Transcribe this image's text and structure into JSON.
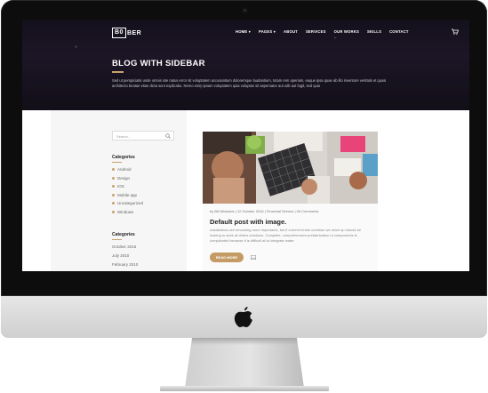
{
  "site": {
    "logo_box": "B0",
    "logo_rest": "BER",
    "nav": [
      "HOME ▾",
      "PAGES ▾",
      "ABOUT",
      "SERVICES",
      "OUR WORKS",
      "SKILLS",
      "CONTACT"
    ]
  },
  "hero": {
    "title": "BLOG WITH SIDEBAR",
    "description": "Sed ut perspiciatis unde omnis iste natus error sit voluptatem accusantium doloremque laudantium, totam rem aperiam, eaque ipsa quae ab illo inventore veritatis et quasi architecto beatae vitae dicta sunt explicabo. Nemo enim ipsam voluptatem quia voluptas sit aspernatur aut odit aut fugit, sed quia"
  },
  "sidebar": {
    "search_placeholder": "Search...",
    "categories_heading": "Categories",
    "categories": [
      "Android",
      "Design",
      "IOS",
      "Mobile app",
      "Uncategorized",
      "Windows"
    ],
    "archives_heading": "Categories",
    "archives": [
      "October 2016",
      "July 2010",
      "February 2010"
    ]
  },
  "post": {
    "meta": "by Bill Michaels   |   12 October 2016   |   Financial Service   |   06 Comments",
    "title": "Default post with image.",
    "excerpt": "Installations are becoming more importants, but if current trends continue we seize up should be looking to seek at others solutions. Complete, comprehensive prefabrication of components is complicated because it is difficult at to integrate water.",
    "read_more": "READ MORE"
  },
  "colors": {
    "accent": "#c49b65",
    "hero_bg": "#1a1422"
  }
}
